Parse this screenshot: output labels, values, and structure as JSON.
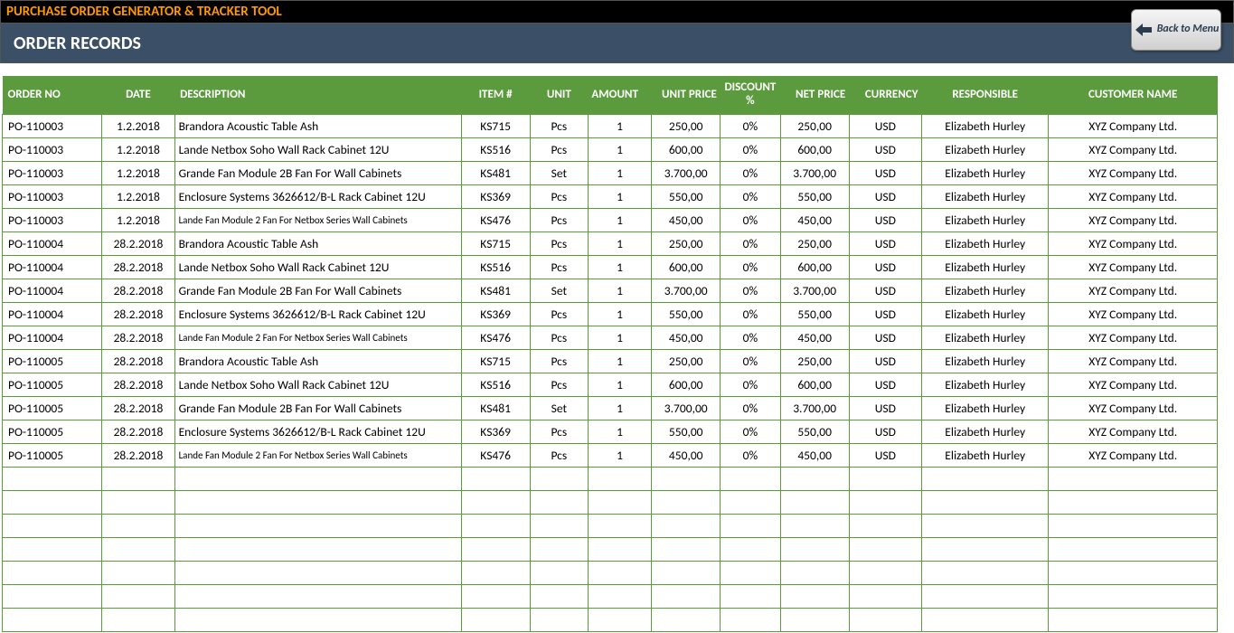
{
  "header": {
    "app_title": "PURCHASE ORDER GENERATOR & TRACKER TOOL",
    "page_title": "ORDER RECORDS",
    "back_button": "Back to Menu"
  },
  "columns": [
    "ORDER NO",
    "DATE",
    "DESCRIPTION",
    "ITEM #",
    "UNIT",
    "AMOUNT",
    "UNIT PRICE",
    "DISCOUNT %",
    "NET PRICE",
    "CURRENCY",
    "RESPONSIBLE",
    "CUSTOMER NAME"
  ],
  "rows": [
    {
      "order": "PO-110003",
      "date": "1.2.2018",
      "desc": "Brandora Acoustic Table Ash",
      "item": "KS715",
      "unit": "Pcs",
      "amount": "1",
      "unitprice": "250,00",
      "discount": "0%",
      "netprice": "250,00",
      "currency": "USD",
      "responsible": "Elizabeth Hurley",
      "customer": "XYZ Company Ltd.",
      "small": false
    },
    {
      "order": "PO-110003",
      "date": "1.2.2018",
      "desc": "Lande Netbox Soho Wall Rack Cabinet 12U",
      "item": "KS516",
      "unit": "Pcs",
      "amount": "1",
      "unitprice": "600,00",
      "discount": "0%",
      "netprice": "600,00",
      "currency": "USD",
      "responsible": "Elizabeth Hurley",
      "customer": "XYZ Company Ltd.",
      "small": false
    },
    {
      "order": "PO-110003",
      "date": "1.2.2018",
      "desc": "Grande Fan Module 2B Fan For Wall Cabinets",
      "item": "KS481",
      "unit": "Set",
      "amount": "1",
      "unitprice": "3.700,00",
      "discount": "0%",
      "netprice": "3.700,00",
      "currency": "USD",
      "responsible": "Elizabeth Hurley",
      "customer": "XYZ Company Ltd.",
      "small": false
    },
    {
      "order": "PO-110003",
      "date": "1.2.2018",
      "desc": "Enclosure Systems 3626612/B-L Rack Cabinet 12U",
      "item": "KS369",
      "unit": "Pcs",
      "amount": "1",
      "unitprice": "550,00",
      "discount": "0%",
      "netprice": "550,00",
      "currency": "USD",
      "responsible": "Elizabeth Hurley",
      "customer": "XYZ Company Ltd.",
      "small": false
    },
    {
      "order": "PO-110003",
      "date": "1.2.2018",
      "desc": "Lande Fan Module 2 Fan For Netbox Series Wall Cabinets",
      "item": "KS476",
      "unit": "Pcs",
      "amount": "1",
      "unitprice": "450,00",
      "discount": "0%",
      "netprice": "450,00",
      "currency": "USD",
      "responsible": "Elizabeth Hurley",
      "customer": "XYZ Company Ltd.",
      "small": true
    },
    {
      "order": "PO-110004",
      "date": "28.2.2018",
      "desc": "Brandora Acoustic Table Ash",
      "item": "KS715",
      "unit": "Pcs",
      "amount": "1",
      "unitprice": "250,00",
      "discount": "0%",
      "netprice": "250,00",
      "currency": "USD",
      "responsible": "Elizabeth Hurley",
      "customer": "XYZ Company Ltd.",
      "small": false
    },
    {
      "order": "PO-110004",
      "date": "28.2.2018",
      "desc": "Lande Netbox Soho Wall Rack Cabinet 12U",
      "item": "KS516",
      "unit": "Pcs",
      "amount": "1",
      "unitprice": "600,00",
      "discount": "0%",
      "netprice": "600,00",
      "currency": "USD",
      "responsible": "Elizabeth Hurley",
      "customer": "XYZ Company Ltd.",
      "small": false
    },
    {
      "order": "PO-110004",
      "date": "28.2.2018",
      "desc": "Grande Fan Module 2B Fan For Wall Cabinets",
      "item": "KS481",
      "unit": "Set",
      "amount": "1",
      "unitprice": "3.700,00",
      "discount": "0%",
      "netprice": "3.700,00",
      "currency": "USD",
      "responsible": "Elizabeth Hurley",
      "customer": "XYZ Company Ltd.",
      "small": false
    },
    {
      "order": "PO-110004",
      "date": "28.2.2018",
      "desc": "Enclosure Systems 3626612/B-L Rack Cabinet 12U",
      "item": "KS369",
      "unit": "Pcs",
      "amount": "1",
      "unitprice": "550,00",
      "discount": "0%",
      "netprice": "550,00",
      "currency": "USD",
      "responsible": "Elizabeth Hurley",
      "customer": "XYZ Company Ltd.",
      "small": false
    },
    {
      "order": "PO-110004",
      "date": "28.2.2018",
      "desc": "Lande Fan Module 2 Fan For Netbox Series Wall Cabinets",
      "item": "KS476",
      "unit": "Pcs",
      "amount": "1",
      "unitprice": "450,00",
      "discount": "0%",
      "netprice": "450,00",
      "currency": "USD",
      "responsible": "Elizabeth Hurley",
      "customer": "XYZ Company Ltd.",
      "small": true
    },
    {
      "order": "PO-110005",
      "date": "28.2.2018",
      "desc": "Brandora Acoustic Table Ash",
      "item": "KS715",
      "unit": "Pcs",
      "amount": "1",
      "unitprice": "250,00",
      "discount": "0%",
      "netprice": "250,00",
      "currency": "USD",
      "responsible": "Elizabeth Hurley",
      "customer": "XYZ Company Ltd.",
      "small": false
    },
    {
      "order": "PO-110005",
      "date": "28.2.2018",
      "desc": "Lande Netbox Soho Wall Rack Cabinet 12U",
      "item": "KS516",
      "unit": "Pcs",
      "amount": "1",
      "unitprice": "600,00",
      "discount": "0%",
      "netprice": "600,00",
      "currency": "USD",
      "responsible": "Elizabeth Hurley",
      "customer": "XYZ Company Ltd.",
      "small": false
    },
    {
      "order": "PO-110005",
      "date": "28.2.2018",
      "desc": "Grande Fan Module 2B Fan For Wall Cabinets",
      "item": "KS481",
      "unit": "Set",
      "amount": "1",
      "unitprice": "3.700,00",
      "discount": "0%",
      "netprice": "3.700,00",
      "currency": "USD",
      "responsible": "Elizabeth Hurley",
      "customer": "XYZ Company Ltd.",
      "small": false
    },
    {
      "order": "PO-110005",
      "date": "28.2.2018",
      "desc": "Enclosure Systems 3626612/B-L Rack Cabinet 12U",
      "item": "KS369",
      "unit": "Pcs",
      "amount": "1",
      "unitprice": "550,00",
      "discount": "0%",
      "netprice": "550,00",
      "currency": "USD",
      "responsible": "Elizabeth Hurley",
      "customer": "XYZ Company Ltd.",
      "small": false
    },
    {
      "order": "PO-110005",
      "date": "28.2.2018",
      "desc": "Lande Fan Module 2 Fan For Netbox Series Wall Cabinets",
      "item": "KS476",
      "unit": "Pcs",
      "amount": "1",
      "unitprice": "450,00",
      "discount": "0%",
      "netprice": "450,00",
      "currency": "USD",
      "responsible": "Elizabeth Hurley",
      "customer": "XYZ Company Ltd.",
      "small": true
    }
  ],
  "empty_rows": 7
}
